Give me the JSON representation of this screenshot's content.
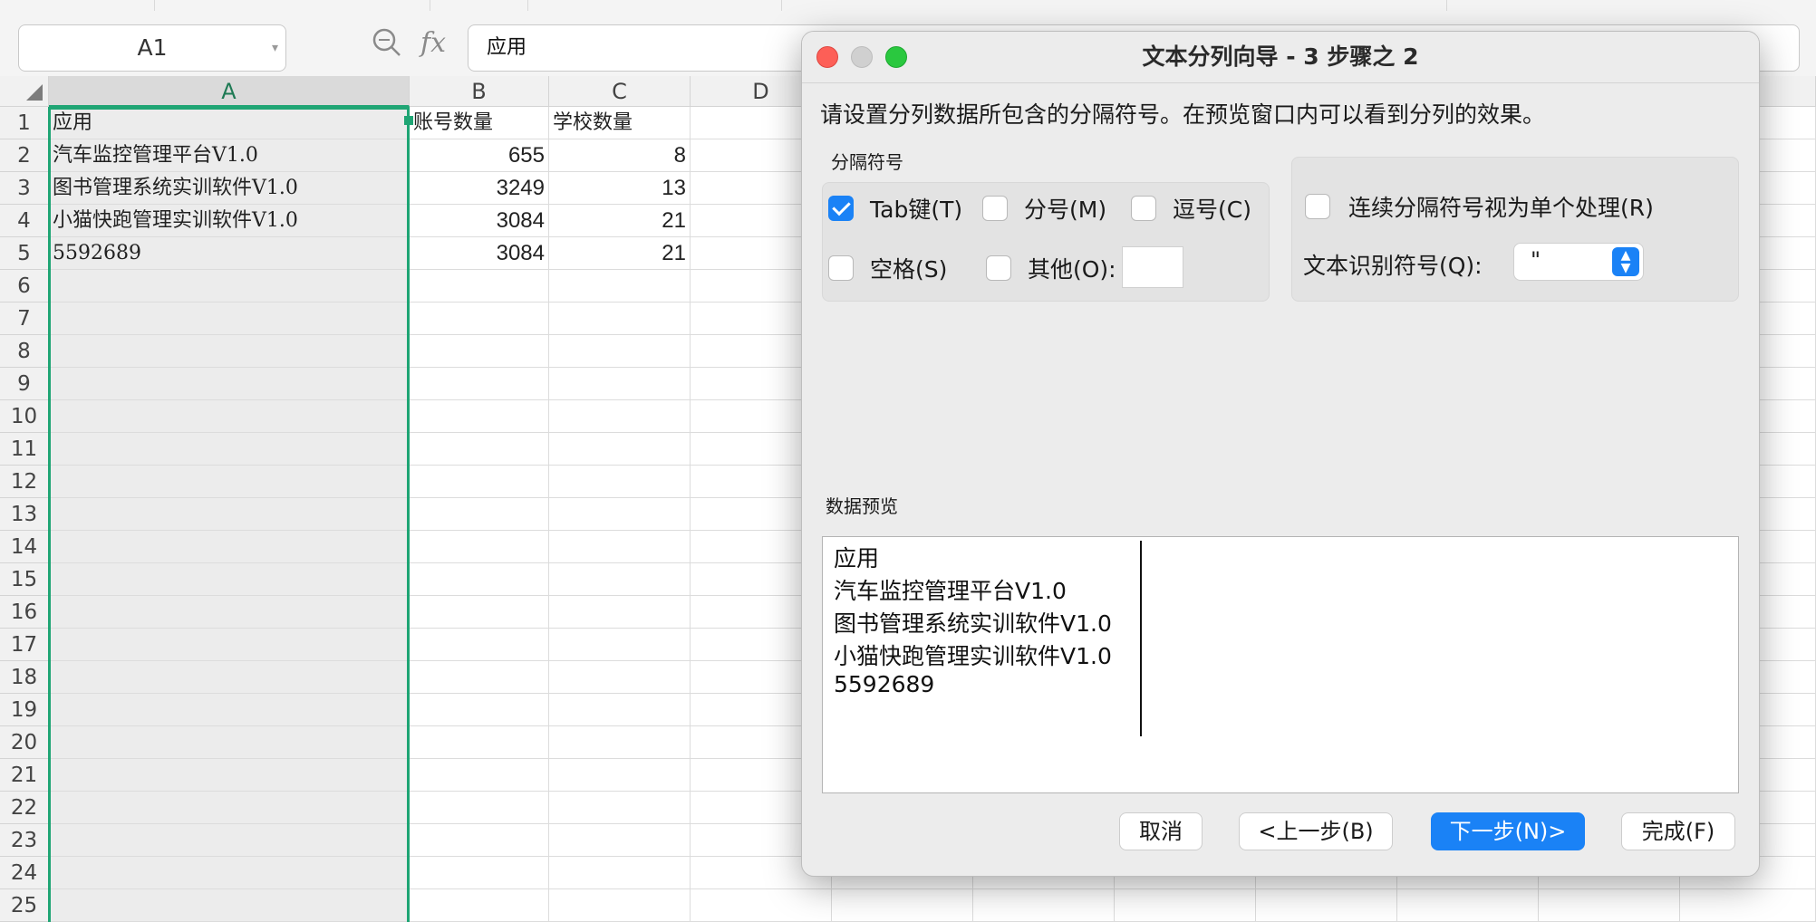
{
  "name_box": {
    "value": "A1"
  },
  "formula_bar": {
    "fx_label": "fx",
    "value": "应用"
  },
  "columns": [
    "A",
    "B",
    "C",
    "D"
  ],
  "rows": [
    "1",
    "2",
    "3",
    "4",
    "5",
    "6",
    "7",
    "8",
    "9",
    "10",
    "11",
    "12",
    "13",
    "14",
    "15",
    "16",
    "17",
    "18",
    "19",
    "20",
    "21",
    "22",
    "23",
    "24",
    "25"
  ],
  "sheet": {
    "a1": "应用",
    "b1": "账号数量",
    "c1": "学校数量",
    "a2": "汽车监控管理平台V1.0",
    "b2": "655",
    "c2": "8",
    "a3": "图书管理系统实训软件V1.0",
    "b3": "3249",
    "c3": "13",
    "a4": "小猫快跑管理实训软件V1.0",
    "b4": "3084",
    "c4": "21",
    "a5": "5592689",
    "b5": "3084",
    "c5": "21"
  },
  "dialog": {
    "title": "文本分列向导 - 3 步骤之 2",
    "instruction": "请设置分列数据所包含的分隔符号。在预览窗口内可以看到分列的效果。",
    "delimiters_label": "分隔符号",
    "tab_label": "Tab键(T)",
    "tab_checked": true,
    "semicolon_label": "分号(M)",
    "comma_label": "逗号(C)",
    "space_label": "空格(S)",
    "other_label": "其他(O):",
    "other_value": "",
    "consecutive_label": "连续分隔符号视为单个处理(R)",
    "qualifier_label": "文本识别符号(Q):",
    "qualifier_value": "\"",
    "preview_label": "数据预览",
    "preview_lines": [
      "应用",
      "汽车监控管理平台V1.0",
      "图书管理系统实训软件V1.0",
      "小猫快跑管理实训软件V1.0",
      "5592689"
    ],
    "buttons": {
      "cancel": "取消",
      "back": "<上一步(B)",
      "next": "下一步(N)>",
      "finish": "完成(F)"
    }
  },
  "colors": {
    "accent": "#1a82f6",
    "selection": "#1fa574"
  }
}
